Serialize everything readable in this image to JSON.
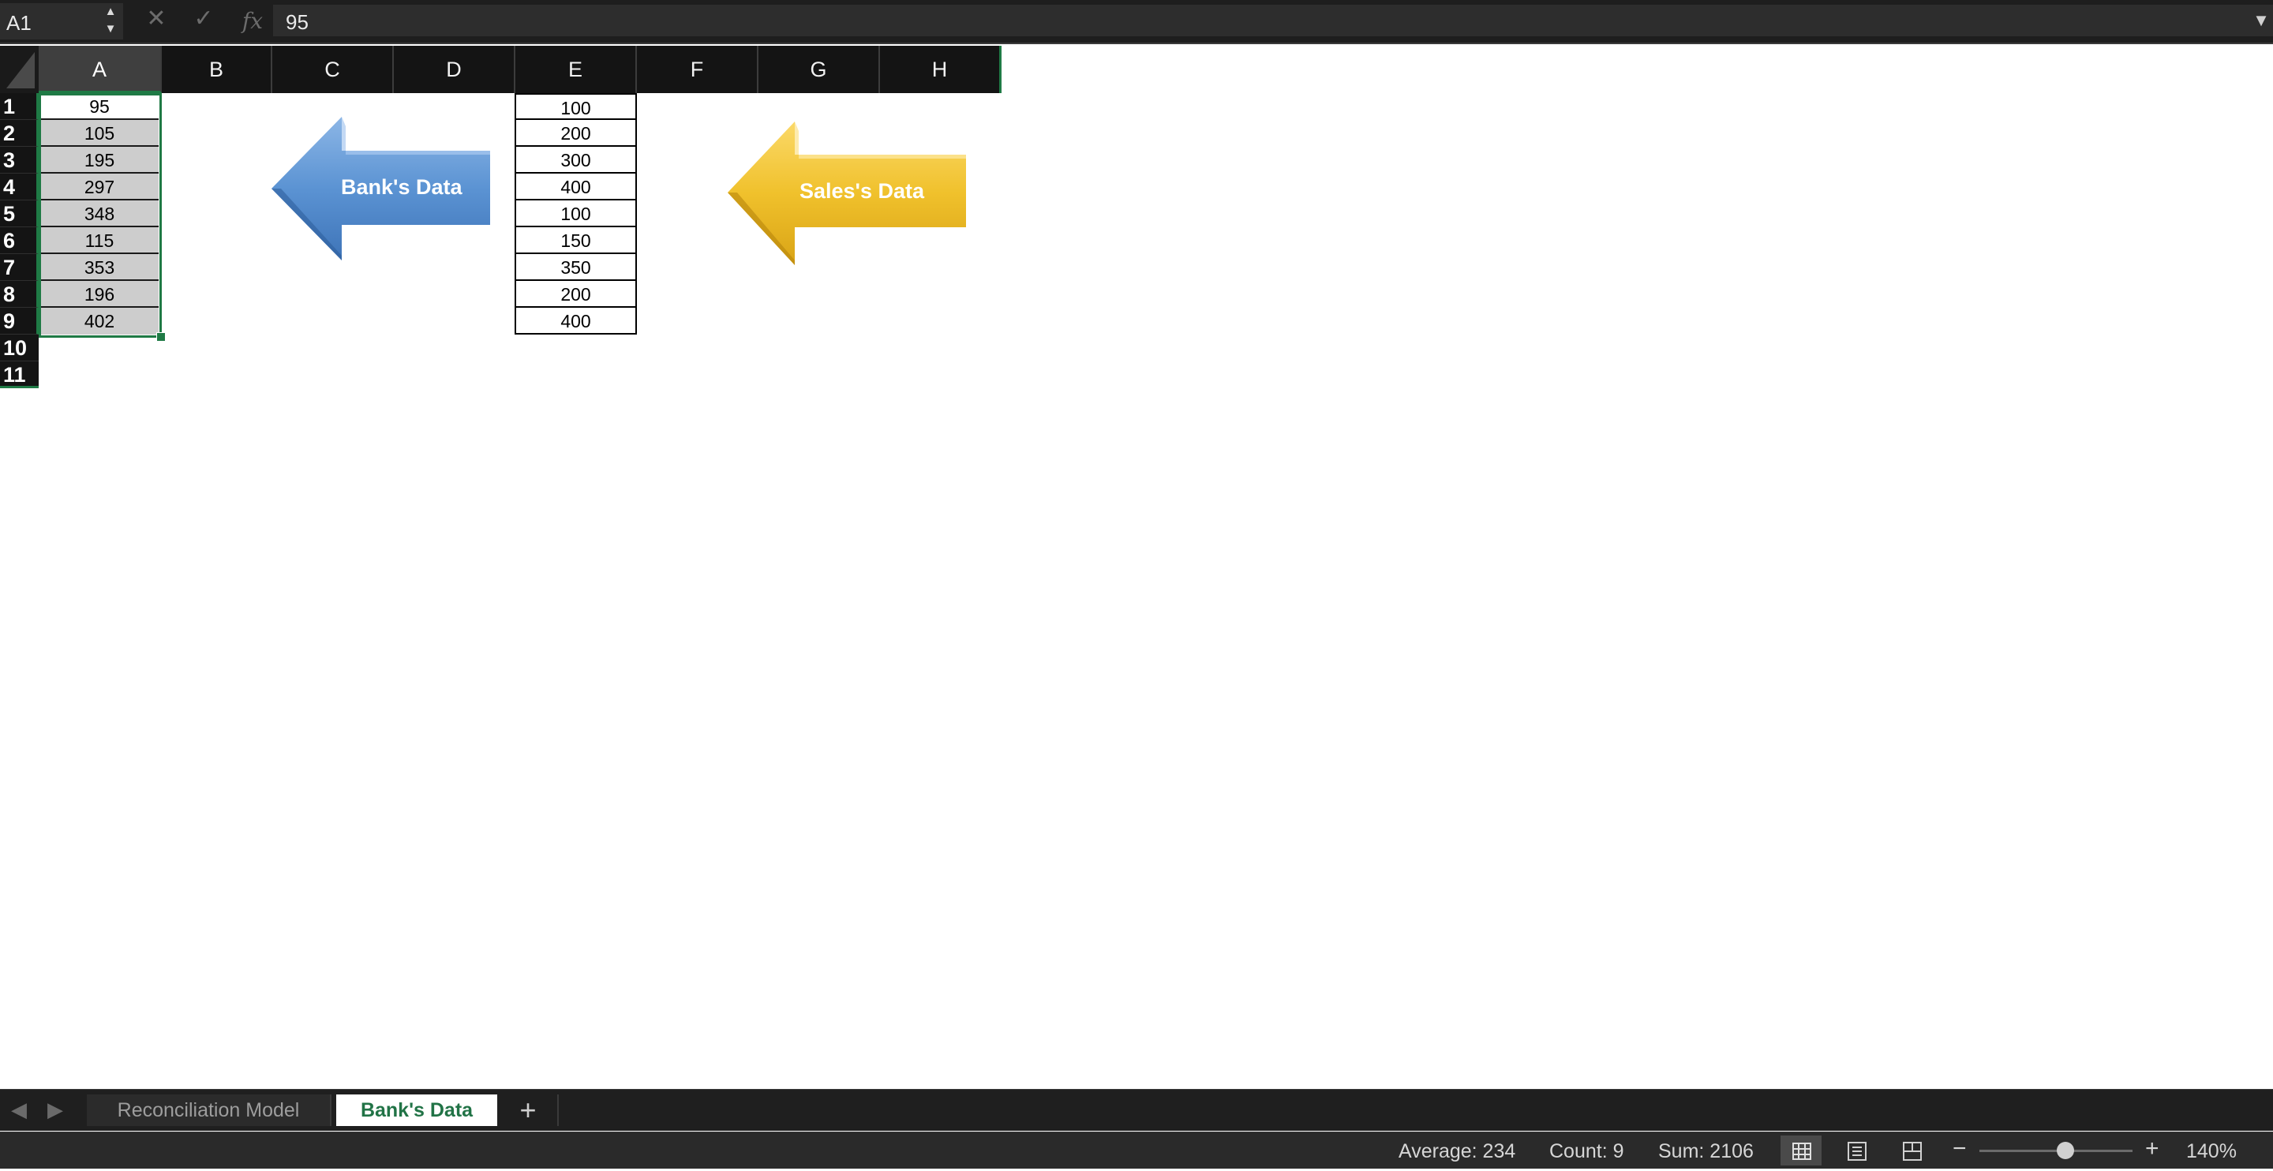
{
  "formula_bar": {
    "cell_ref": "A1",
    "formula_value": "95",
    "cancel_icon": "x-icon",
    "enter_icon": "check-icon",
    "function_icon": "fx-icon",
    "fx_label": "fx"
  },
  "columns": [
    "A",
    "B",
    "C",
    "D",
    "E",
    "F",
    "G",
    "H"
  ],
  "rows": [
    "1",
    "2",
    "3",
    "4",
    "5",
    "6",
    "7",
    "8",
    "9",
    "10",
    "11"
  ],
  "column_a": [
    "95",
    "105",
    "195",
    "297",
    "348",
    "115",
    "353",
    "196",
    "402"
  ],
  "column_e": [
    "100",
    "200",
    "300",
    "400",
    "100",
    "150",
    "350",
    "200",
    "400"
  ],
  "shapes": {
    "bank_arrow_label": "Bank's Data",
    "sales_arrow_label": "Sales's Data",
    "bank_color": "#5b93d3",
    "sales_color": "#f0c12c"
  },
  "sheet_tabs": {
    "tabs": [
      "Reconciliation Model",
      "Bank's Data"
    ],
    "active": "Bank's Data",
    "add_label": "+"
  },
  "status_bar": {
    "average": "Average: 234",
    "count": "Count: 9",
    "sum": "Sum: 2106",
    "zoom": "140%",
    "zoom_out_label": "−",
    "zoom_in_label": "+"
  },
  "colors": {
    "selection_green": "#1f7a45",
    "active_tab_text": "#217346"
  }
}
